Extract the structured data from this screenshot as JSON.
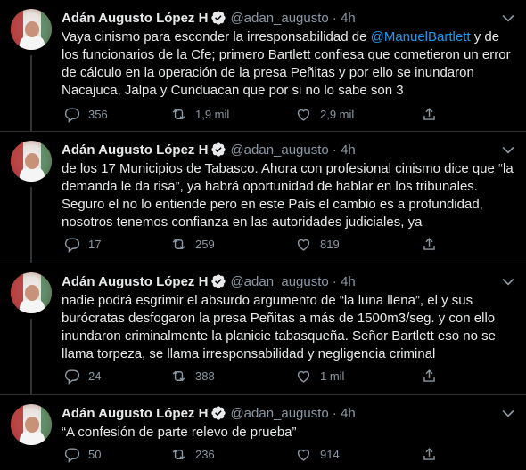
{
  "tweets": [
    {
      "name": "Adán Augusto López H",
      "handle": "@adan_augusto · 4h",
      "text_before": "Vaya cinismo para esconder la irresponsabilidad de ",
      "mention": "@ManuelBartlett",
      "text_after": " y de los funcionarios de la Cfe; primero Bartlett confiesa que cometieron un error de cálculo en la operación de la presa Peñitas y por ello se inundaron Nacajuca, Jalpa y Cunduacan que por si no lo sabe son 3",
      "replies": "356",
      "retweets": "1,9 mil",
      "likes": "2,9 mil"
    },
    {
      "name": "Adán Augusto López H",
      "handle": "@adan_augusto · 4h",
      "text": "de los 17 Municipios de Tabasco. Ahora con profesional cinismo dice que “la demanda le da risa”, ya habrá oportunidad de hablar en los tribunales. Seguro el no lo entiende pero en este País el cambio es a profundidad, nosotros tenemos confianza en las autoridades judiciales, ya",
      "replies": "17",
      "retweets": "259",
      "likes": "819"
    },
    {
      "name": "Adán Augusto López H",
      "handle": "@adan_augusto · 4h",
      "text": "nadie podrá esgrimir el absurdo argumento de “la luna llena”, el y sus burócratas desfogaron la presa Peñitas a más de 1500m3/seg. y con ello inundaron criminalmente la planicie tabasqueña. Señor Bartlett eso no se llama torpeza, se llama irresponsabilidad y negligencia criminal",
      "replies": "24",
      "retweets": "388",
      "likes": "1 mil"
    },
    {
      "name": "Adán Augusto López H",
      "handle": "@adan_augusto · 4h",
      "text": "“A confesión de parte relevo de prueba”",
      "replies": "50",
      "retweets": "236",
      "likes": "914"
    }
  ],
  "icons": {
    "reply": "reply-icon",
    "retweet": "retweet-icon",
    "like": "like-icon",
    "share": "share-icon",
    "more": "chevron-down-icon",
    "verified": "verified-badge-icon"
  },
  "colors": {
    "background": "#000000",
    "text": "#e7e9ea",
    "secondary": "#8b98a5",
    "link": "#1d9bf0",
    "border": "#2f3336"
  }
}
